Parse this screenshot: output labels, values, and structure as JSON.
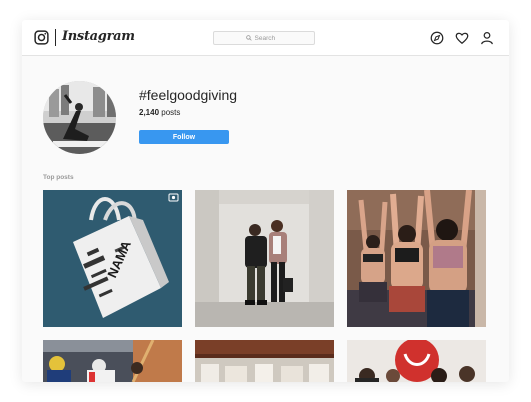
{
  "header": {
    "wordmark": "Instagram",
    "search_placeholder": "Search",
    "icons": [
      "instagram-logo-icon",
      "compass-icon",
      "heart-icon",
      "user-icon"
    ]
  },
  "profile": {
    "hashtag": "#feelgoodgiving",
    "post_count": "2,140",
    "post_label": "posts",
    "follow_label": "Follow"
  },
  "section": {
    "title": "Top posts"
  },
  "posts": [
    {
      "id": "post-1",
      "description": "bag",
      "bag_text": "NAMA"
    },
    {
      "id": "post-2",
      "description": "couple"
    },
    {
      "id": "post-3",
      "description": "yoga"
    },
    {
      "id": "post-4",
      "description": "cyclists"
    },
    {
      "id": "post-5",
      "description": "store"
    },
    {
      "id": "post-6",
      "description": "group"
    }
  ],
  "colors": {
    "accent": "#3897f0",
    "text": "#262626",
    "muted": "#999999"
  }
}
